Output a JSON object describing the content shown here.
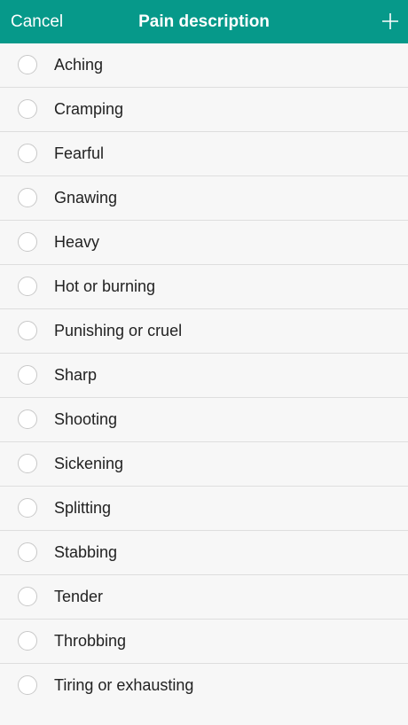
{
  "header": {
    "cancel_label": "Cancel",
    "title": "Pain description",
    "add_icon": "plus-icon"
  },
  "options": [
    {
      "label": "Aching",
      "selected": false
    },
    {
      "label": "Cramping",
      "selected": false
    },
    {
      "label": "Fearful",
      "selected": false
    },
    {
      "label": "Gnawing",
      "selected": false
    },
    {
      "label": "Heavy",
      "selected": false
    },
    {
      "label": "Hot or burning",
      "selected": false
    },
    {
      "label": "Punishing or cruel",
      "selected": false
    },
    {
      "label": "Sharp",
      "selected": false
    },
    {
      "label": "Shooting",
      "selected": false
    },
    {
      "label": "Sickening",
      "selected": false
    },
    {
      "label": "Splitting",
      "selected": false
    },
    {
      "label": "Stabbing",
      "selected": false
    },
    {
      "label": "Tender",
      "selected": false
    },
    {
      "label": "Throbbing",
      "selected": false
    },
    {
      "label": "Tiring or exhausting",
      "selected": false
    }
  ],
  "colors": {
    "header_bg": "#06998a",
    "header_text": "#ffffff",
    "page_bg": "#f7f7f7",
    "divider": "#dedede",
    "radio_border": "#c8c8c8",
    "text": "#222222"
  }
}
